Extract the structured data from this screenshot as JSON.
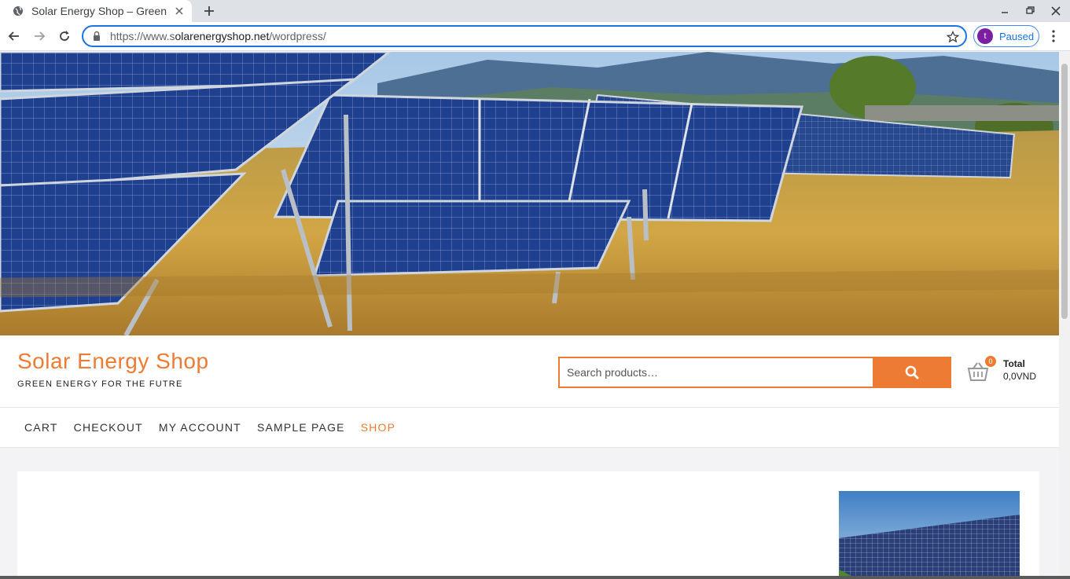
{
  "browser": {
    "tab_title": "Solar Energy Shop – Green Energy for the Futre",
    "url_scheme": "https://www.s",
    "url_rest": "olarenergyshop.net",
    "url_path": "/wordpress/",
    "profile_initial": "t",
    "profile_status": "Paused",
    "icons": [
      "globe-icon",
      "close-icon",
      "plus-icon",
      "minimize-icon",
      "restore-icon",
      "close-window-icon",
      "back-arrow-icon",
      "forward-arrow-icon",
      "reload-icon",
      "lock-icon",
      "star-icon",
      "kebab-menu-icon"
    ]
  },
  "site": {
    "title": "Solar Energy Shop",
    "tagline": "GREEN ENERGY FOR THE FUTRE",
    "accent_color": "#ee7b33"
  },
  "search": {
    "placeholder": "Search products…"
  },
  "cart": {
    "count": "0",
    "total_label": "Total",
    "total_value": "0,0VND"
  },
  "nav": {
    "items": [
      {
        "label": "CART",
        "active": false
      },
      {
        "label": "CHECKOUT",
        "active": false
      },
      {
        "label": "MY ACCOUNT",
        "active": false
      },
      {
        "label": "SAMPLE PAGE",
        "active": false
      },
      {
        "label": "SHOP",
        "active": true
      }
    ]
  }
}
